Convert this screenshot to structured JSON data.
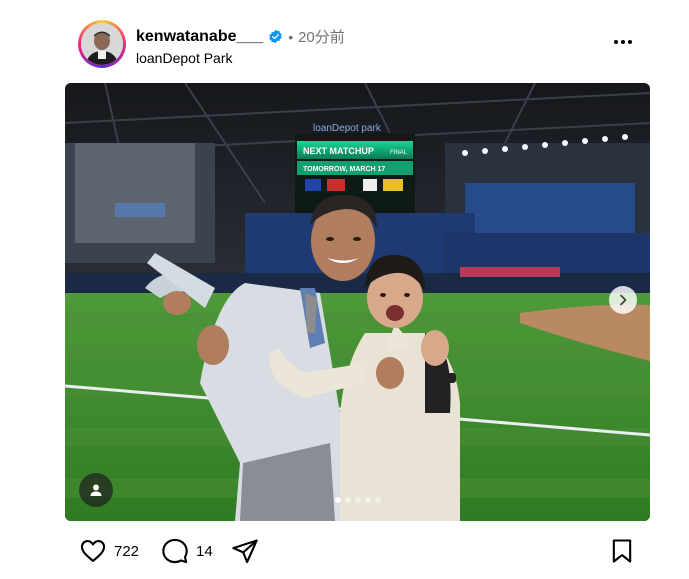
{
  "post": {
    "username": "kenwatanabe___",
    "separator": "•",
    "time_ago": "20分前",
    "location": "loanDepot Park",
    "verified": true
  },
  "scoreboard": {
    "brand": "loanDepot park",
    "header": "NEXT MATCHUP",
    "tag": "FINAL",
    "date": "TOMORROW, MARCH 17"
  },
  "carousel": {
    "slide_count": 5,
    "active_index": 0
  },
  "actions": {
    "likes": "722",
    "comments": "14"
  },
  "icons": {
    "like": "heart-icon",
    "comment": "comment-icon",
    "share": "send-icon",
    "save": "bookmark-icon",
    "more": "more-icon",
    "next": "chevron-right-icon",
    "tag": "user-tag-icon"
  },
  "colors": {
    "verified": "#0095f6",
    "secondary_text": "#737373",
    "grass": "#3f8a2d",
    "scoreboard_green": "#17c98a"
  }
}
